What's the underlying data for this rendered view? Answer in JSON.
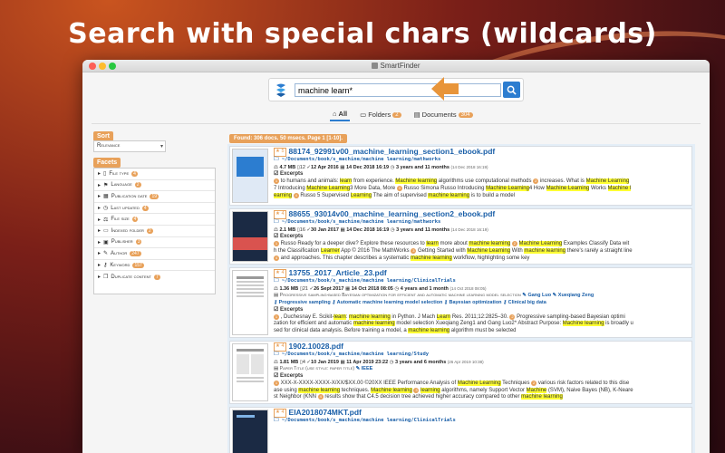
{
  "headline": "Search with special chars (wildcards)",
  "window": {
    "title": "SmartFinder"
  },
  "search": {
    "value": "machine learn*",
    "placeholder": ""
  },
  "tabs": [
    {
      "label": "All",
      "count": ""
    },
    {
      "label": "Folders",
      "count": "2"
    },
    {
      "label": "Documents",
      "count": "304"
    }
  ],
  "sort": {
    "label": "Sort",
    "value": "Relevance"
  },
  "facets_label": "Facets",
  "facets": [
    {
      "label": "File type",
      "count": "4"
    },
    {
      "label": "Language",
      "count": "2"
    },
    {
      "label": "Publication date",
      "count": "19"
    },
    {
      "label": "Last updated",
      "count": "4"
    },
    {
      "label": "File size",
      "count": "4"
    },
    {
      "label": "Indexed folder",
      "count": "2"
    },
    {
      "label": "Publisher",
      "count": "3"
    },
    {
      "label": "Author",
      "count": "247"
    },
    {
      "label": "Keyword",
      "count": "157"
    },
    {
      "label": "Duplicate content",
      "count": "7"
    }
  ],
  "found": "Found: 306 docs. 50 msecs. Page 1 [1-10].",
  "results": [
    {
      "stars": "5",
      "title": "88174_92991v00_machine_learning_section1_ebook.pdf",
      "path": "~/Documents/book/s_machine/machine learning/mathworks",
      "size": "4.7 MB",
      "pages": "12",
      "created": "12 Apr 2016",
      "modified": "14 Dec 2018 16:19",
      "age": "3 years and 11 months",
      "age_date": "(14 Dec 2018 16:19)",
      "excerpts_label": "Excerpts",
      "l1a": "to humans and animals:",
      "l1b": "learn",
      "l1c": "from experience.",
      "l1d": "Machine learning",
      "l1e": "algorithms use computational methods",
      "l1f": "increases. What is",
      "l1g": "Machine Learning",
      "l2a": "7 Introducing",
      "l2b": "Machine Learning",
      "l2c": "3 More Data, More",
      "l2d": "Russo Simona Russo Introducing",
      "l2e": "Machine Learning",
      "l2f": "4 How",
      "l2g": "Machine Learning",
      "l2h": "Works",
      "l2i": "Machine l",
      "l3a": "earning",
      "l3b": "Russo 5 Supervised",
      "l3c": "Learning",
      "l3d": "The aim of supervised",
      "l3e": "machine learning",
      "l3f": "is to build a model"
    },
    {
      "stars": "4",
      "title": "88655_93014v00_machine_learning_section2_ebook.pdf",
      "path": "~/Documents/book/s_machine/machine learning/mathworks",
      "size": "2.1 MB",
      "pages": "16",
      "created": "30 Jan 2017",
      "modified": "14 Dec 2018 16:19",
      "age": "3 years and 11 months",
      "age_date": "(14 Dec 2018 16:19)",
      "excerpts_label": "Excerpts",
      "l1a": "Russo Ready for a deeper dive? Explore these resources to",
      "l1b": "learn",
      "l1c": "more about",
      "l1d": "machine learning",
      "l1e": "Machine Learning",
      "l1f": "Examples Classify Data wit",
      "l2a": "h the Classification",
      "l2b": "Learner",
      "l2c": "App © 2016 The MathWorks",
      "l2d": "Getting Started with",
      "l2e": "Machine Learning",
      "l2f": "With",
      "l2g": "machine learning",
      "l2h": "there's rarely a straight line",
      "l3a": "and approaches. This chapter describes a systematic",
      "l3b": "machine learning",
      "l3c": "workflow, highlighting some key"
    },
    {
      "stars": "4",
      "title": "13755_2017_Article_23.pdf",
      "path": "~/Documents/book/s_machine/machine learning/ClinicalTrials",
      "size": "1.36 MB",
      "pages": "21",
      "created": "26 Sept 2017",
      "modified": "14 Oct 2018 08:05",
      "age": "4 years and 1 month",
      "age_date": "(14 Oct 2018 08:05)",
      "subtitle": "Progressive sampling-based Bayesian optimization for efficient and automatic machine learning model selection",
      "author1": "Gang Luo",
      "author2": "Xueqiang Zeng",
      "kw1": "Progressive sampling",
      "kw2": "Automatic machine learning model selection",
      "kw3": "Bayesian optimization",
      "kw4": "Clinical big data",
      "excerpts_label": "Excerpts",
      "l1a": ", Duchesnay E. Scikit-",
      "l1b": "learn",
      "l1c": ":",
      "l1d": "machine learning",
      "l1e": "in Python. J Mach",
      "l1f": "Learn",
      "l1g": "Res. 2011;12:2825–30.",
      "l1h": "Progressive sampling-based Bayesian optimi",
      "l2a": "zation for efficient and automatic",
      "l2b": "machine learning",
      "l2c": "model selection Xueqiang Zeng1 and Gang Luo2* Abstract Purpose:",
      "l2d": "Machine learning",
      "l2e": "is broadly u",
      "l3a": "sed for clinical data analysis. Before training a model, a",
      "l3b": "machine learning",
      "l3c": "algorithm must be selected"
    },
    {
      "stars": "4",
      "title": "1902.10028.pdf",
      "path": "~/Documents/book/s_machine/machine learning/Study",
      "size": "1.81 MB",
      "pages": "4",
      "created": "10 Jan 2019",
      "modified": "11 Apr 2019 23:22",
      "age": "3 years and 6 months",
      "age_date": "(26 Apr 2019 10:38)",
      "subtitle": "Paper Title (use style: paper title)",
      "author1": "IEEE",
      "excerpts_label": "Excerpts",
      "l1a": "XXX-X-XXXX-XXXX-X/XX/$XX.00 ©20XX IEEE Performance Analysis of",
      "l1b": "Machine Learning",
      "l1c": "Techniques",
      "l1d": "various risk factors related to this dise",
      "l2a": "ase using",
      "l2b": "machine learning",
      "l2c": "techniques.",
      "l2d": "Machine learning",
      "l2e": "learning",
      "l2f": "algorithms, namely Support Vector",
      "l2g": "Machine",
      "l2h": "(SVM), Naive Bayes (NB), K-Neare",
      "l3a": "st Neighbor (KNN",
      "l3b": "results show that C4.5 decision tree achieved higher accuracy compared to other",
      "l3c": "machine learning"
    },
    {
      "stars": "4",
      "title": "EIA2018074MKT.pdf",
      "path": "~/Documents/book/s_machine/machine learning/ClinicalTrials"
    }
  ]
}
